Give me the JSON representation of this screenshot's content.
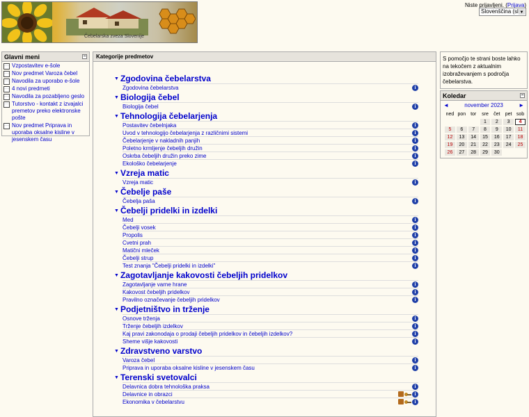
{
  "header": {
    "banner_caption": "Čebelarska zveza Slovenije",
    "login_text": "Niste prijavljeni.",
    "login_link": "Prijava",
    "language": "Slovenščina (sl)"
  },
  "main_menu": {
    "title": "Glavni meni",
    "items": [
      "Vzpostavitev e-šole",
      "Nov predmet Varoza čebel",
      "Navodila za uporabo e-šole",
      "4 novi predmeti",
      "Navodila za pozabljeno geslo",
      "Tutorstvo - kontakt z izvajalci premetov preko elektronske pošte",
      "Nov predmet Priprava in uporaba oksalne kisline v jesenskem času"
    ]
  },
  "center": {
    "title": "Kategorije predmetov",
    "categories": [
      {
        "name": "Zgodovina čebelarstva",
        "courses": [
          "Zgodovina čebelarstva"
        ]
      },
      {
        "name": "Biologija čebel",
        "courses": [
          "Biologija čebel"
        ]
      },
      {
        "name": "Tehnologija čebelarjenja",
        "courses": [
          "Postavitev čebelnjaka",
          "Uvod v tehnologijo čebelarjenja z različnimi sistemi",
          "Čebelarjenje v nakladnih panjih",
          "Poletno krmljenje čebeljih družin",
          "Oskrba čebeljih družin preko zime",
          "Ekološko čebelarjenje"
        ]
      },
      {
        "name": "Vzreja matic",
        "courses": [
          "Vzreja matic"
        ]
      },
      {
        "name": "Čebelje paše",
        "courses": [
          "Čebelja paša"
        ]
      },
      {
        "name": "Čebelji pridelki in izdelki",
        "courses": [
          "Med",
          "Čebelji vosek",
          "Propolis",
          "Cvetni prah",
          "Matični mleček",
          "Čebelji strup",
          "Test znanja \"Čebelji pridelki in izdelki\""
        ]
      },
      {
        "name": "Zagotavljanje kakovosti čebeljih pridelkov",
        "courses": [
          "Zagotavljanje varne hrane",
          "Kakovost čebeljih pridelkov",
          "Pravilno označevanje čebeljih pridelkov"
        ]
      },
      {
        "name": "Podjetništvo in trženje",
        "courses": [
          "Osnove trženja",
          "Trženje čebeljih izdelkov",
          "Kaj pravi zakonodaja o prodaji čebeljih pridelkov in čebeljih izdelkov?",
          "Sheme višje kakovosti"
        ]
      },
      {
        "name": "Zdravstveno varstvo",
        "courses": [
          "Varoza čebel",
          "Priprava in uporaba oksalne kisline v jesenskem času"
        ]
      },
      {
        "name": "Terenski svetovalci",
        "courses": [
          "Delavnica dobra tehnološka praksa",
          "Delavnice in obrazci",
          "Ekonomika v čebelarstvu"
        ]
      }
    ],
    "info_glyph": "i"
  },
  "help_text": "S pomočjo te strani boste lahko na tekočem z aktualnim izobraževanjem s področja čebelarstva.",
  "calendar": {
    "title": "Koledar",
    "month": "november 2023",
    "prev": "◄",
    "next": "►",
    "weekdays": [
      "ned",
      "pon",
      "tor",
      "sre",
      "čet",
      "pet",
      "sob"
    ],
    "weeks": [
      [
        "",
        "",
        "",
        "1",
        "2",
        "3",
        "4"
      ],
      [
        "5",
        "6",
        "7",
        "8",
        "9",
        "10",
        "11"
      ],
      [
        "12",
        "13",
        "14",
        "15",
        "16",
        "17",
        "18"
      ],
      [
        "19",
        "20",
        "21",
        "22",
        "23",
        "24",
        "25"
      ],
      [
        "26",
        "27",
        "28",
        "29",
        "30",
        "",
        ""
      ]
    ],
    "today": "4"
  },
  "icons": {
    "collapse": "collapse-icon",
    "document": "document-icon",
    "category": "triangle-bullet-icon",
    "info": "info-icon",
    "key": "guest-key-icon",
    "enrol": "enrol-icon"
  }
}
